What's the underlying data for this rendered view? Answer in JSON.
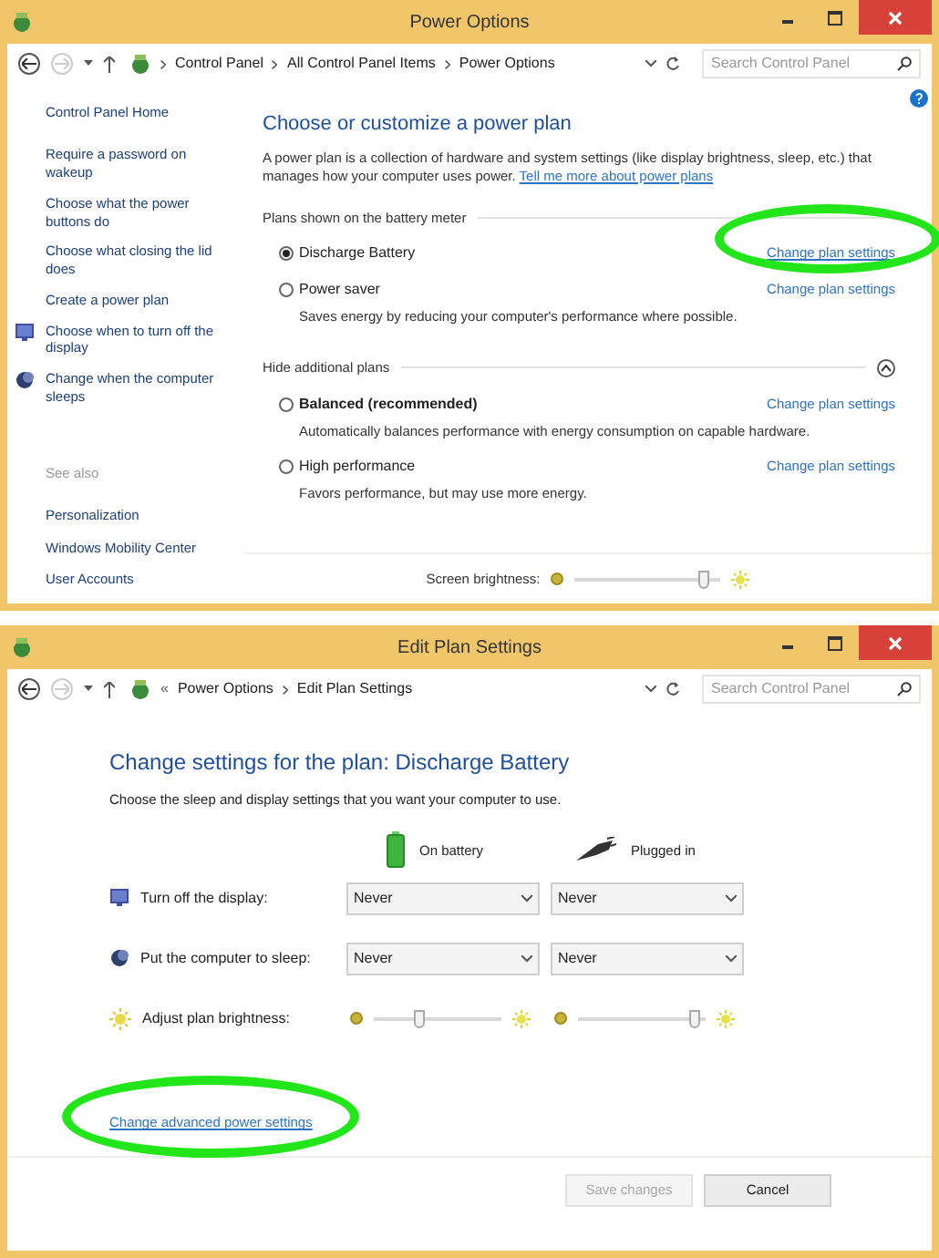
{
  "power_options_window": {
    "title": "Power Options",
    "address_bar": {
      "breadcrumbs": [
        "Control Panel",
        "All Control Panel Items",
        "Power Options"
      ],
      "search_placeholder": "Search Control Panel"
    },
    "sidebar": {
      "home": "Control Panel Home",
      "tasks": [
        {
          "label": "Require a password on wakeup"
        },
        {
          "label": "Choose what the power buttons do"
        },
        {
          "label": "Choose what closing the lid does"
        },
        {
          "label": "Create a power plan"
        },
        {
          "label": "Choose when to turn off the display"
        },
        {
          "label": "Change when the computer sleeps"
        }
      ],
      "see_also_title": "See also",
      "see_also": [
        "Personalization",
        "Windows Mobility Center",
        "User Accounts"
      ]
    },
    "main": {
      "heading": "Choose or customize a power plan",
      "description": "A power plan is a collection of hardware and system settings (like display brightness, sleep, etc.) that manages how your computer uses power.",
      "description_link": "Tell me more about power plans",
      "battery_meter_section": "Plans shown on the battery meter",
      "plans": [
        {
          "name": "Discharge Battery",
          "selected": true,
          "emphasized": false,
          "link": "Change plan settings"
        },
        {
          "name": "Power saver",
          "description": "Saves energy by reducing your computer's performance where possible.",
          "selected": false,
          "emphasized": false,
          "link": "Change plan settings"
        }
      ],
      "additional_section": "Hide additional plans",
      "additional_expanded": true,
      "additional_plans": [
        {
          "name": "Balanced (recommended)",
          "description": "Automatically balances performance with energy consumption on capable hardware.",
          "selected": false,
          "emphasized": true,
          "link": "Change plan settings"
        },
        {
          "name": "High performance",
          "description": "Favors performance, but may use more energy.",
          "selected": false,
          "emphasized": false,
          "link": "Change plan settings"
        }
      ],
      "brightness": {
        "label": "Screen brightness:",
        "level": 0.88
      }
    }
  },
  "edit_plan_window": {
    "title": "Edit Plan Settings",
    "address_bar": {
      "overflow": "«",
      "breadcrumbs": [
        "Power Options",
        "Edit Plan Settings"
      ],
      "search_placeholder": "Search Control Panel"
    },
    "heading": "Change settings for the plan: Discharge Battery",
    "description": "Choose the sleep and display settings that you want your computer to use.",
    "columns": [
      {
        "label": "On battery"
      },
      {
        "label": "Plugged in"
      }
    ],
    "settings": [
      {
        "kind": "select",
        "label": "Turn off the display:",
        "values": [
          "Never",
          "Never"
        ]
      },
      {
        "kind": "select",
        "label": "Put the computer to sleep:",
        "values": [
          "Never",
          "Never"
        ]
      },
      {
        "kind": "slider",
        "label": "Adjust plan brightness:",
        "sliders": [
          {
            "level": 0.35
          },
          {
            "level": 0.92
          }
        ]
      }
    ],
    "advanced_link": "Change advanced power settings",
    "buttons": [
      {
        "label": "Save changes",
        "disabled": true
      },
      {
        "label": "Cancel",
        "disabled": false
      }
    ]
  }
}
